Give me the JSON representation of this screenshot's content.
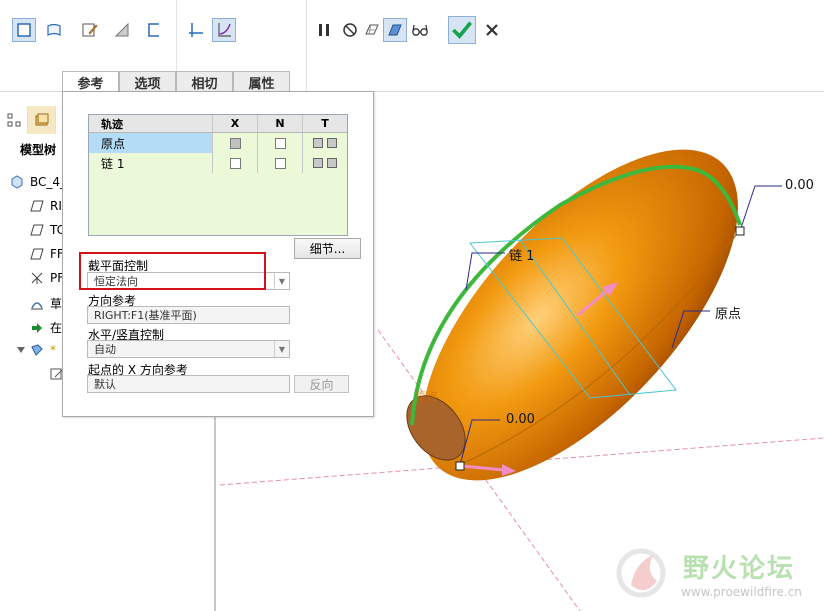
{
  "ribbon": {
    "icons": [
      "solid-sweep-icon",
      "surface-sweep-icon",
      "sketch-icon",
      "remove-material-icon",
      "thicken-icon",
      "constant-section-icon",
      "variable-section-icon"
    ],
    "control_icons": [
      "pause-icon",
      "no-preview-icon",
      "check-model-icon",
      "verify-icon",
      "glasses-icon",
      "confirm-icon",
      "cancel-icon"
    ]
  },
  "tabs": [
    {
      "label": "参考",
      "active": true
    },
    {
      "label": "选项",
      "active": false
    },
    {
      "label": "相切",
      "active": false
    },
    {
      "label": "属性",
      "active": false
    }
  ],
  "trajectory_table": {
    "headers": [
      "轨迹",
      "X",
      "N",
      "T"
    ],
    "rows": [
      {
        "name": "原点",
        "x": true,
        "n": false,
        "selected": true
      },
      {
        "name": "链 1",
        "x": false,
        "n": false,
        "selected": false
      }
    ]
  },
  "detail_button": "细节...",
  "section_plane_control": {
    "label": "截平面控制",
    "value": "恒定法向"
  },
  "direction_reference": {
    "label": "方向参考",
    "value": "RIGHT:F1(基准平面)"
  },
  "hv_control": {
    "label": "水平/竖直控制",
    "value": "自动"
  },
  "x_direction_ref": {
    "label": "起点的 X 方向参考",
    "value": "默认",
    "flip_button": "反向"
  },
  "tree": {
    "title": "模型树",
    "items": [
      {
        "label": "BC_4_",
        "icon": "part-icon"
      },
      {
        "label": "RI",
        "icon": "datum-plane-icon"
      },
      {
        "label": "TC",
        "icon": "datum-plane-icon"
      },
      {
        "label": "FF",
        "icon": "datum-plane-icon"
      },
      {
        "label": "PF",
        "icon": "csys-icon"
      },
      {
        "label": "草",
        "icon": "sketch-icon"
      },
      {
        "label": "在",
        "icon": "insert-here-icon"
      },
      {
        "label": "*",
        "icon": "sweep-feature-icon"
      },
      {
        "label": "",
        "icon": "edit-icon"
      }
    ]
  },
  "viewport": {
    "labels": [
      "0.00",
      "链 1",
      "原点",
      "0.00",
      "原点"
    ],
    "watermark": {
      "text": "野火论坛",
      "url": "www.proewildfire.cn"
    }
  },
  "colors": {
    "accent_red": "#d0121b",
    "body_orange": "#f08a00",
    "trajectory_green": "#3db83d"
  }
}
